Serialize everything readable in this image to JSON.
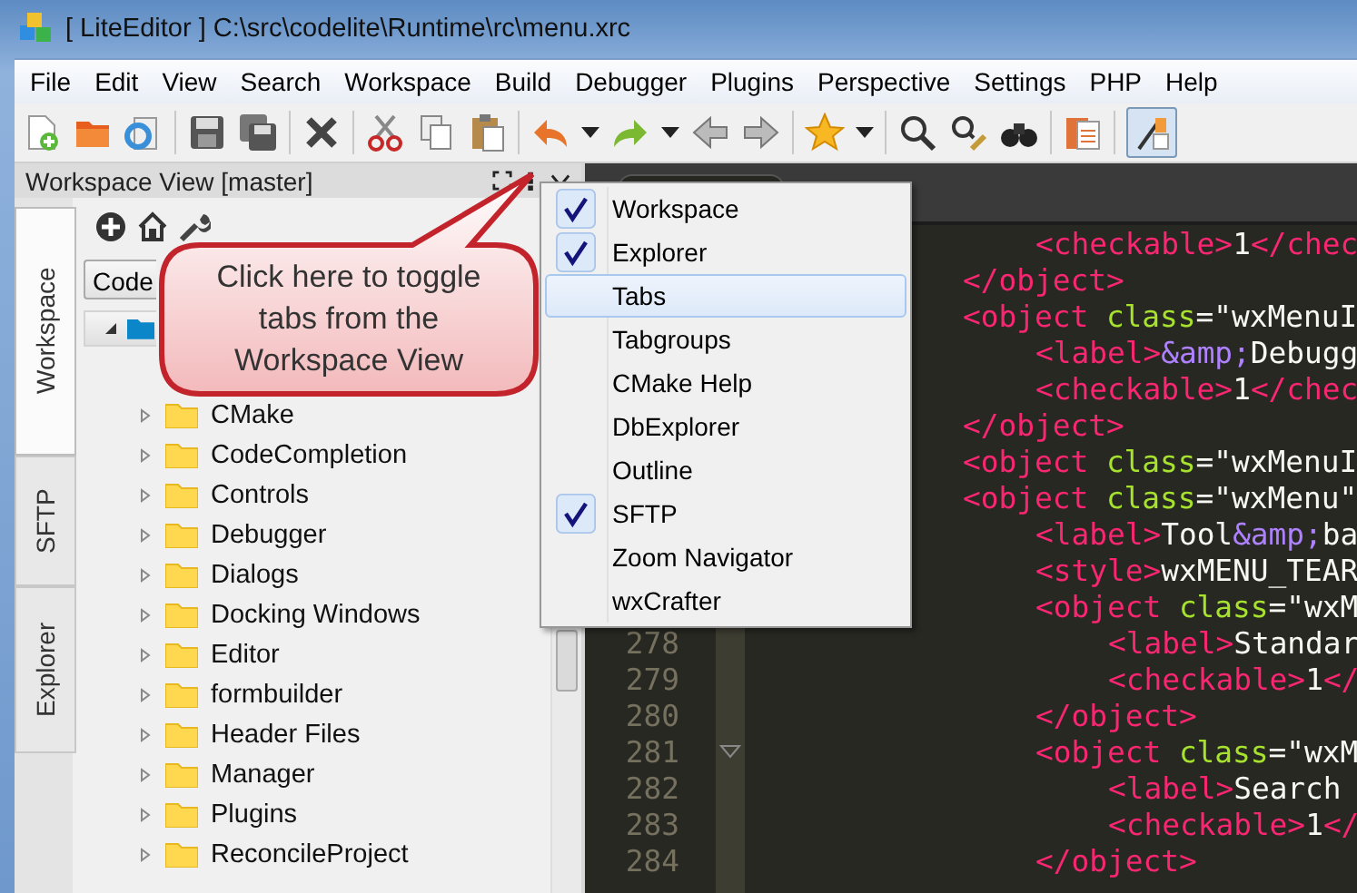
{
  "window": {
    "title": "[ LiteEditor ] C:\\src\\codelite\\Runtime\\rc\\menu.xrc"
  },
  "menu_bar": [
    "File",
    "Edit",
    "View",
    "Search",
    "Workspace",
    "Build",
    "Debugger",
    "Plugins",
    "Perspective",
    "Settings",
    "PHP",
    "Help"
  ],
  "toolbar": {
    "paint_tool_pressed": true
  },
  "workspace_panel": {
    "title": "Workspace View [master]",
    "tabs": [
      {
        "label": "Workspace",
        "selected": true
      },
      {
        "label": "SFTP",
        "selected": false
      },
      {
        "label": "Explorer",
        "selected": false
      }
    ],
    "project_dropdown": {
      "value": "Code"
    },
    "tree": [
      {
        "label": "CMake"
      },
      {
        "label": "CodeCompletion"
      },
      {
        "label": "Controls"
      },
      {
        "label": "Debugger"
      },
      {
        "label": "Dialogs"
      },
      {
        "label": "Docking Windows"
      },
      {
        "label": "Editor"
      },
      {
        "label": "formbuilder"
      },
      {
        "label": "Header Files"
      },
      {
        "label": "Manager"
      },
      {
        "label": "Plugins"
      },
      {
        "label": "ReconcileProject"
      }
    ]
  },
  "tabs_menu": {
    "items": [
      {
        "label": "Workspace",
        "checked": true,
        "selected": false
      },
      {
        "label": "Explorer",
        "checked": true,
        "selected": false
      },
      {
        "label": "Tabs",
        "checked": false,
        "selected": true
      },
      {
        "label": "Tabgroups",
        "checked": false,
        "selected": false
      },
      {
        "label": "CMake Help",
        "checked": false,
        "selected": false
      },
      {
        "label": "DbExplorer",
        "checked": false,
        "selected": false
      },
      {
        "label": "Outline",
        "checked": false,
        "selected": false
      },
      {
        "label": "SFTP",
        "checked": true,
        "selected": false
      },
      {
        "label": "Zoom Navigator",
        "checked": false,
        "selected": false
      },
      {
        "label": "wxCrafter",
        "checked": false,
        "selected": false
      }
    ]
  },
  "callout": {
    "text": "Click here to toggle tabs from the Workspace View"
  },
  "editor": {
    "lines": [
      {
        "kind": "indent2",
        "fold_marker": false,
        "tokens": [
          {
            "kind": "tag",
            "text": "<checkable>"
          },
          {
            "kind": "text",
            "text": "1"
          },
          {
            "kind": "tag",
            "text": "</chec"
          }
        ]
      },
      {
        "kind": "indent1",
        "fold_marker": false,
        "tokens": [
          {
            "kind": "tag",
            "text": "</object>"
          }
        ]
      },
      {
        "kind": "indent1",
        "fold_marker": false,
        "tokens": [
          {
            "kind": "tag",
            "text": "<object"
          },
          {
            "kind": "attr",
            "text": "class"
          },
          {
            "kind": "text",
            "text": "=\"wxMenuI"
          }
        ]
      },
      {
        "kind": "indent2",
        "fold_marker": false,
        "tokens": [
          {
            "kind": "tag",
            "text": "<label>"
          },
          {
            "kind": "entity",
            "text": "&amp;"
          },
          {
            "kind": "text",
            "text": "Debugg"
          }
        ]
      },
      {
        "kind": "indent2",
        "fold_marker": false,
        "tokens": [
          {
            "kind": "tag",
            "text": "<checkable>"
          },
          {
            "kind": "text",
            "text": "1"
          },
          {
            "kind": "tag",
            "text": "</chec"
          }
        ]
      },
      {
        "kind": "indent1",
        "fold_marker": false,
        "tokens": [
          {
            "kind": "tag",
            "text": "</object>"
          }
        ]
      },
      {
        "kind": "indent1",
        "fold_marker": false,
        "tokens": [
          {
            "kind": "tag",
            "text": "<object"
          },
          {
            "kind": "attr",
            "text": "class"
          },
          {
            "kind": "text",
            "text": "=\"wxMenuI"
          }
        ]
      },
      {
        "kind": "indent1",
        "fold_marker": false,
        "tokens": [
          {
            "kind": "tag",
            "text": "<object"
          },
          {
            "kind": "attr",
            "text": "class"
          },
          {
            "kind": "text",
            "text": "=\"wxMenu\""
          }
        ]
      },
      {
        "kind": "indent2",
        "fold_marker": false,
        "tokens": [
          {
            "kind": "tag",
            "text": "<label>"
          },
          {
            "kind": "text",
            "text": "Tool"
          },
          {
            "kind": "entity",
            "text": "&amp;"
          },
          {
            "kind": "text",
            "text": "ba"
          }
        ]
      },
      {
        "kind": "indent2",
        "fold_marker": false,
        "tokens": [
          {
            "kind": "tag",
            "text": "<style>"
          },
          {
            "kind": "text",
            "text": "wxMENU_TEAR"
          }
        ]
      },
      {
        "kind": "indent2",
        "fold_marker": false,
        "tokens": [
          {
            "kind": "tag",
            "text": "<object"
          },
          {
            "kind": "attr",
            "text": "class"
          },
          {
            "kind": "text",
            "text": "=\"wxM"
          }
        ]
      },
      {
        "number": "278",
        "kind": "indent3",
        "fold_marker": false,
        "tokens": [
          {
            "kind": "tag",
            "text": "<label>"
          },
          {
            "kind": "text",
            "text": "Standar"
          }
        ]
      },
      {
        "number": "279",
        "kind": "indent3",
        "fold_marker": false,
        "tokens": [
          {
            "kind": "tag",
            "text": "<checkable>"
          },
          {
            "kind": "text",
            "text": "1"
          },
          {
            "kind": "tag",
            "text": "</"
          }
        ]
      },
      {
        "number": "280",
        "kind": "indent2",
        "fold_marker": false,
        "tokens": [
          {
            "kind": "tag",
            "text": "</object>"
          }
        ]
      },
      {
        "number": "281",
        "kind": "indent2",
        "fold_marker": true,
        "tokens": [
          {
            "kind": "tag",
            "text": "<object"
          },
          {
            "kind": "attr",
            "text": "class"
          },
          {
            "kind": "text",
            "text": "=\"wxM"
          }
        ]
      },
      {
        "number": "282",
        "kind": "indent3",
        "fold_marker": false,
        "tokens": [
          {
            "kind": "tag",
            "text": "<label>"
          },
          {
            "kind": "text",
            "text": "Search"
          }
        ]
      },
      {
        "number": "283",
        "kind": "indent3",
        "fold_marker": false,
        "tokens": [
          {
            "kind": "tag",
            "text": "<checkable>"
          },
          {
            "kind": "text",
            "text": "1"
          },
          {
            "kind": "tag",
            "text": "</"
          }
        ]
      },
      {
        "number": "284",
        "kind": "indent2",
        "fold_marker": false,
        "tokens": [
          {
            "kind": "tag",
            "text": "</object>"
          }
        ]
      }
    ]
  }
}
